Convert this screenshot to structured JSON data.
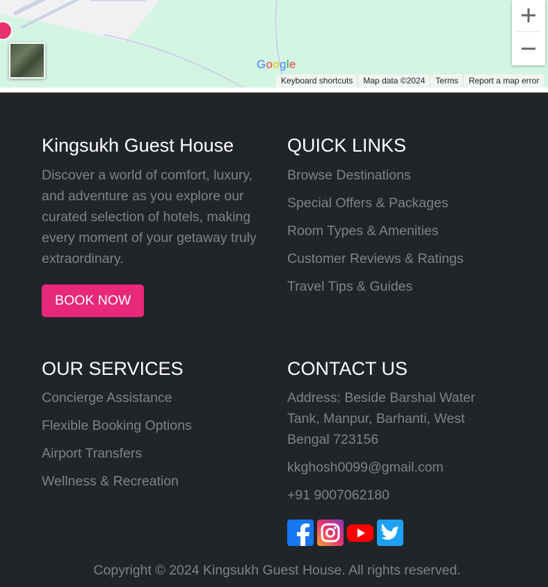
{
  "map": {
    "zoom_in_label": "+",
    "zoom_out_label": "−",
    "logo_text": "Google",
    "attribution": [
      "Keyboard shortcuts",
      "Map data ©2024",
      "Terms",
      "Report a map error"
    ],
    "background": "#d4f5e4"
  },
  "about": {
    "title": "Kingsukh Guest House",
    "description": "Discover a world of comfort, luxury, and adventure as you explore our curated selection of hotels, making every moment of your getaway truly extraordinary.",
    "book_label": "BOOK NOW"
  },
  "quick_links": {
    "title": "QUICK LINKS",
    "items": [
      "Browse Destinations",
      "Special Offers & Packages",
      "Room Types & Amenities",
      "Customer Reviews & Ratings",
      "Travel Tips & Guides"
    ]
  },
  "services": {
    "title": "OUR SERVICES",
    "items": [
      "Concierge Assistance",
      "Flexible Booking Options",
      "Airport Transfers",
      "Wellness & Recreation"
    ]
  },
  "contact": {
    "title": "CONTACT US",
    "address": "Address: Beside Barshal Water Tank, Manpur, Barhanti, West Bengal 723156",
    "email": "kkghosh0099@gmail.com",
    "phone": "+91 9007062180"
  },
  "social": [
    "facebook-icon",
    "instagram-icon",
    "youtube-icon",
    "twitter-icon"
  ],
  "copyright": "Copyright © 2024 Kingsukh Guest House. All rights reserved.",
  "colors": {
    "footer_bg": "#212529",
    "accent": "#e8287a",
    "muted_text": "#7d8389"
  }
}
